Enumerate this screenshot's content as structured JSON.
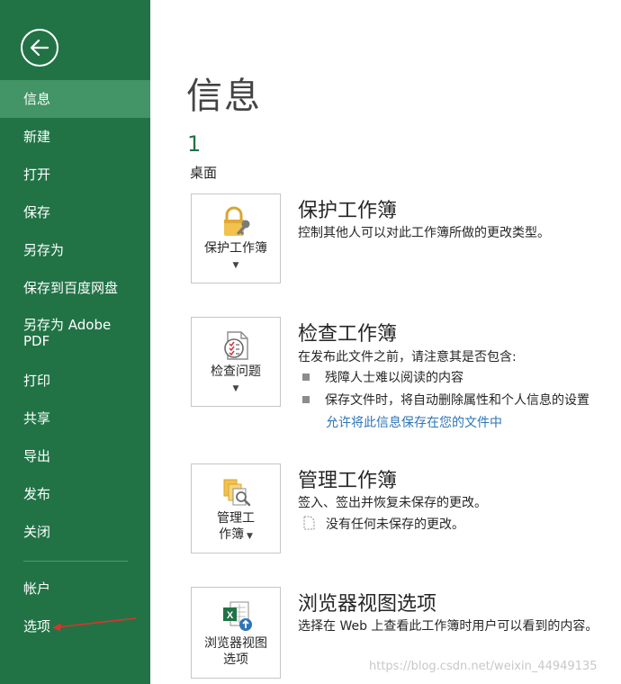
{
  "sidebar": {
    "back_icon": "arrow-left-icon",
    "items": [
      {
        "label": "信息",
        "selected": true
      },
      {
        "label": "新建"
      },
      {
        "label": "打开"
      },
      {
        "label": "保存"
      },
      {
        "label": "另存为"
      },
      {
        "label": "保存到百度网盘"
      },
      {
        "label": "另存为 Adobe PDF"
      },
      {
        "label": "打印"
      },
      {
        "label": "共享"
      },
      {
        "label": "导出"
      },
      {
        "label": "发布"
      },
      {
        "label": "关闭"
      },
      {
        "label": "帐户"
      },
      {
        "label": "选项"
      }
    ]
  },
  "main": {
    "title": "信息",
    "doc_name": "1",
    "doc_location": "桌面",
    "sections": [
      {
        "tile_label": "保护工作簿",
        "tile_icon": "lock-key-icon",
        "title": "保护工作簿",
        "description": "控制其他人可以对此工作簿所做的更改类型。"
      },
      {
        "tile_label": "检查问题",
        "tile_icon": "checklist-icon",
        "title": "检查工作簿",
        "description": "在发布此文件之前，请注意其是否包含:",
        "bullets": [
          "残障人士难以阅读的内容",
          "保存文件时，将自动删除属性和个人信息的设置"
        ],
        "link": "允许将此信息保存在您的文件中"
      },
      {
        "tile_label_line1": "管理工",
        "tile_label_line2": "作簿",
        "tile_icon": "manage-versions-icon",
        "title": "管理工作簿",
        "description": "签入、签出并恢复未保存的更改。",
        "note": "没有任何未保存的更改。"
      },
      {
        "tile_label_line1": "浏览器视图",
        "tile_label_line2": "选项",
        "tile_icon": "excel-browser-icon",
        "title": "浏览器视图选项",
        "description": "选择在 Web 上查看此工作簿时用户可以看到的内容。"
      }
    ]
  },
  "watermark": "https://blog.csdn.net/weixin_44949135",
  "colors": {
    "sidebar_bg": "#217346",
    "sidebar_selected": "#439467",
    "accent_green": "#217346",
    "link": "#2e75b6",
    "annotation_arrow": "#e0322a"
  }
}
